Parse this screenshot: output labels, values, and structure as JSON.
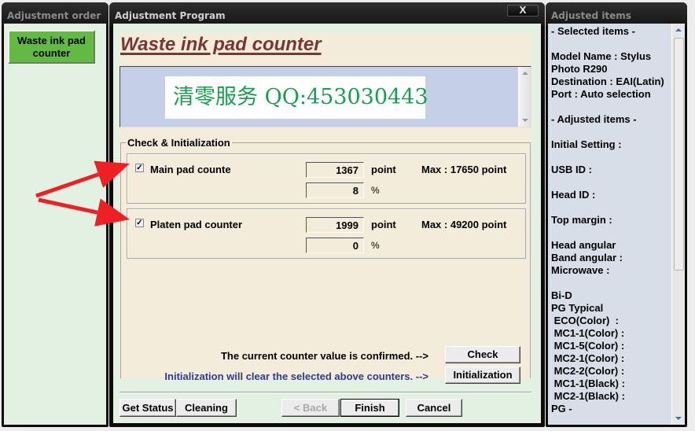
{
  "windows": {
    "order": {
      "title": "Adjustment order",
      "items": [
        {
          "label": "Waste ink pad counter",
          "selected": true,
          "color": "#62ba44"
        }
      ]
    },
    "program": {
      "title": "Adjustment Program",
      "close_label": "X",
      "page_title": "Waste ink pad counter",
      "banner_text": "清零服务 QQ:453030443",
      "group_title": "Check & Initialization",
      "counters": [
        {
          "label": "Main pad counte",
          "checked": true,
          "check_glyph": "✓",
          "value": "1367",
          "unit": "point",
          "percent": "8",
          "percent_unit": "%",
          "max": "Max : 17650 point"
        },
        {
          "label": "Platen pad counter",
          "checked": true,
          "check_glyph": "✓",
          "value": "1999",
          "unit": "point",
          "percent": "0",
          "percent_unit": "%",
          "max": "Max : 49200 point"
        }
      ],
      "check_message": "The current counter value is confirmed. -->",
      "check_button": "Check",
      "init_message": "Initialization will clear the selected above counters. -->",
      "init_button": "Initialization",
      "footer": {
        "get_status": "Get Status",
        "cleaning": "Cleaning",
        "back": "< Back",
        "finish": "Finish",
        "cancel": "Cancel"
      }
    },
    "adjusted": {
      "title": "Adjusted items",
      "lines": [
        "- Selected items -",
        "",
        "Model Name : Stylus",
        "Photo R290",
        "Destination : EAI(Latin)",
        "Port : Auto selection",
        "",
        "- Adjusted items -",
        "",
        "Initial Setting :",
        "",
        "USB ID :",
        "",
        "Head ID :",
        "",
        "Top margin :",
        "",
        "Head angular",
        "Band angular :",
        "Microwave :",
        "",
        "Bi-D",
        "PG Typical",
        " ECO(Color)  :",
        " MC1-1(Color) :",
        " MC1-5(Color) :",
        " MC2-1(Color) :",
        " MC2-2(Color) :",
        " MC1-1(Black) :",
        " MC2-1(Black) :",
        "PG -"
      ]
    }
  },
  "annotation": {
    "color": "#ee2024",
    "arrows": 2
  }
}
